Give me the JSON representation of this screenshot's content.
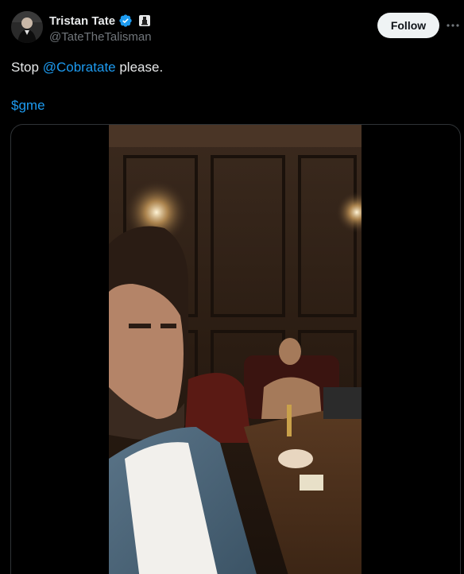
{
  "author": {
    "display_name": "Tristan Tate",
    "handle": "@TateTheTalisman",
    "verified": true,
    "avatar_icon": "avatar-photo"
  },
  "actions": {
    "follow_label": "Follow",
    "more_icon": "more-horizontal-icon"
  },
  "tweet": {
    "text_prefix": "Stop ",
    "mention": "@Cobratate",
    "text_suffix": " please.",
    "cashtag": "$gme"
  },
  "media": {
    "type": "video",
    "description_icon": "video-thumbnail"
  },
  "colors": {
    "background": "#000000",
    "text": "#e7e9ea",
    "muted": "#71767b",
    "link": "#1d9bf0",
    "verified": "#1d9bf0",
    "follow_bg": "#eff3f4"
  }
}
